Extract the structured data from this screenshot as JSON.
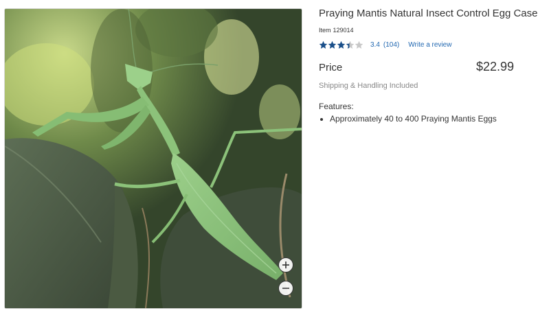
{
  "product": {
    "title": "Praying Mantis Natural Insect Control Egg Case",
    "item_label": "Item",
    "item_number": "129014",
    "rating": {
      "value": "3.4",
      "count": "(104)",
      "stars_filled": 3.4,
      "stars_total": 5,
      "write_review": "Write a review"
    },
    "price_label": "Price",
    "price": "$22.99",
    "shipping": "Shipping & Handling Included",
    "features_label": "Features:",
    "features": [
      "Approximately 40 to 400 Praying Mantis Eggs"
    ]
  },
  "image": {
    "subject": "praying-mantis-photo",
    "zoom_in_icon": "plus-icon",
    "zoom_out_icon": "minus-icon"
  },
  "colors": {
    "star_filled": "#1a4f8a",
    "star_empty": "#c8c8c8",
    "link": "#1f66b0",
    "muted_text": "#888888"
  }
}
